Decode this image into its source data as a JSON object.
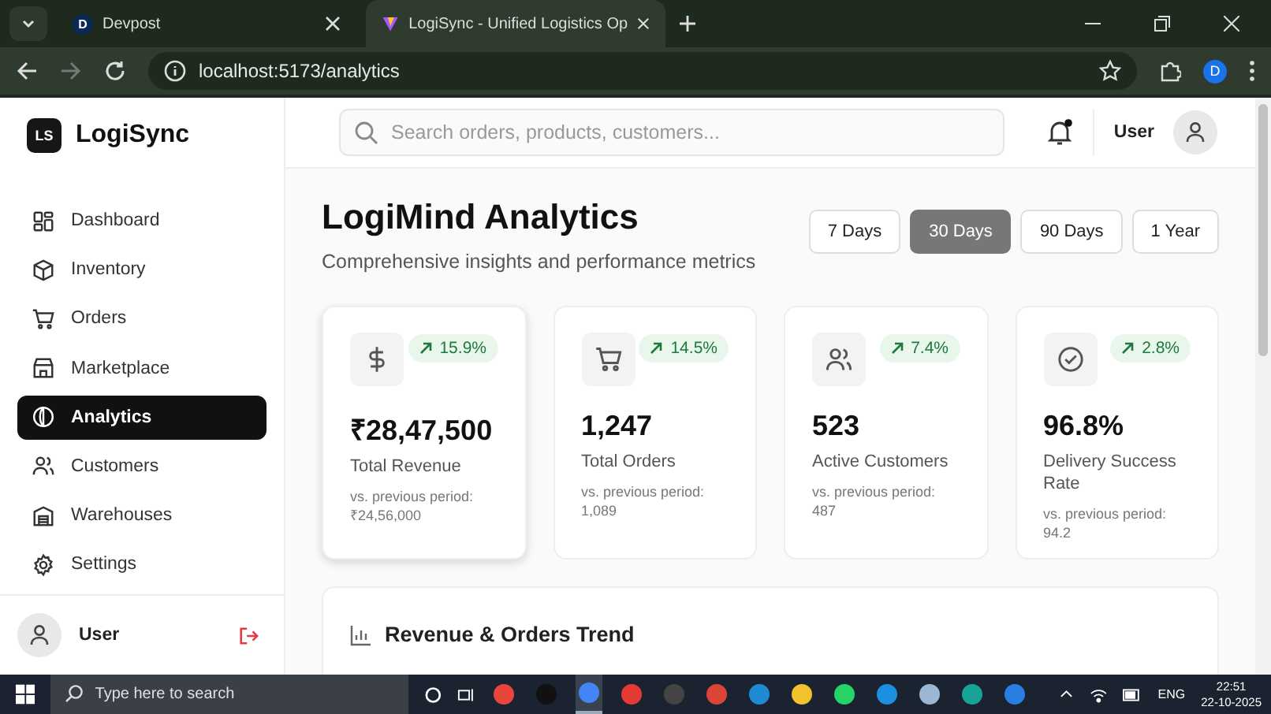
{
  "browser": {
    "tabs": [
      {
        "title": "Devpost",
        "favicon": "D",
        "selected": false
      },
      {
        "title": "LogiSync - Unified Logistics Op",
        "selected": true
      }
    ],
    "url": "localhost:5173/analytics",
    "profile": "D"
  },
  "sidebar": {
    "logo": {
      "mark": "LS",
      "name": "LogiSync"
    },
    "items": [
      {
        "label": "Dashboard",
        "selected": false
      },
      {
        "label": "Inventory",
        "selected": false
      },
      {
        "label": "Orders",
        "selected": false
      },
      {
        "label": "Marketplace",
        "selected": false
      },
      {
        "label": "Analytics",
        "selected": true
      },
      {
        "label": "Customers",
        "selected": false
      },
      {
        "label": "Warehouses",
        "selected": false
      },
      {
        "label": "Settings",
        "selected": false
      }
    ],
    "user": {
      "name": "User"
    }
  },
  "header": {
    "search": {
      "placeholder": "Search orders, products, customers..."
    },
    "notification_unread": true,
    "user": "User"
  },
  "page": {
    "title": "LogiMind Analytics",
    "subtitle": "Comprehensive insights and performance metrics",
    "ranges": [
      {
        "label": "7 Days",
        "selected": false
      },
      {
        "label": "30 Days",
        "selected": true
      },
      {
        "label": "90 Days",
        "selected": false
      },
      {
        "label": "1 Year",
        "selected": false
      }
    ],
    "metrics": [
      {
        "value": "₹28,47,500",
        "label": "Total Revenue",
        "change": "15.9%",
        "previous_label": "vs. previous period:",
        "previous": "₹24,56,000",
        "highlighted": true
      },
      {
        "value": "1,247",
        "label": "Total Orders",
        "change": "14.5%",
        "previous_label": "vs. previous period:",
        "previous": "1,089",
        "highlighted": false
      },
      {
        "value": "523",
        "label": "Active Customers",
        "change": "7.4%",
        "previous_label": "vs. previous period:",
        "previous": "487",
        "highlighted": false
      },
      {
        "value": "96.8%",
        "label": "Delivery Success Rate",
        "change": "2.8%",
        "previous_label": "vs. previous period:",
        "previous": "94.2",
        "highlighted": false
      }
    ],
    "trend": {
      "title": "Revenue & Orders Trend"
    }
  },
  "taskbar": {
    "search": {
      "placeholder": "Type here to search"
    },
    "language": "ENG",
    "time": "22:51",
    "date": "22-10-2025"
  }
}
